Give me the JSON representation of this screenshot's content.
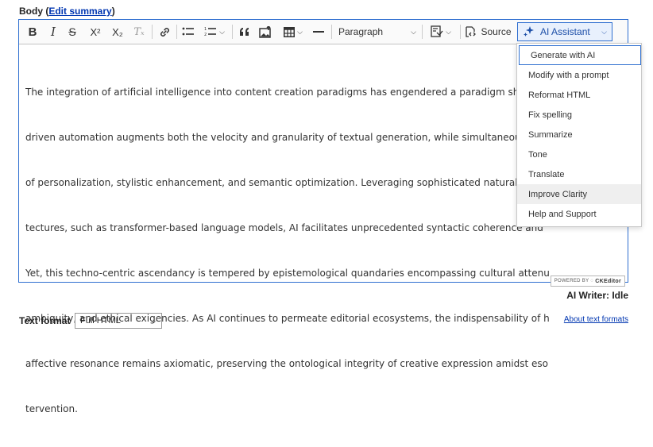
{
  "field": {
    "label": "Body",
    "edit_link_open": "(",
    "edit_link": "Edit summary",
    "edit_link_close": ")"
  },
  "toolbar": {
    "bold_icon": "B",
    "italic_icon": "I",
    "strike_icon": "S",
    "superscript_icon": "X²",
    "subscript_icon": "X₂",
    "remove_format_icon": "Tₓ",
    "paragraph_label": "Paragraph",
    "source_label": "Source",
    "ai_assistant_label": "AI Assistant"
  },
  "content_lines": [
    "The integration of artificial intelligence into content creation paradigms has engendered a paradigm shift, w",
    "driven automation augments both the velocity and granularity of textual generation, while simultaneously re",
    "of personalization, stylistic enhancement, and semantic optimization. Leveraging sophisticated natural langu",
    "tectures, such as transformer-based language models, AI facilitates unprecedented syntactic coherence and ",
    "Yet, this techno-centric ascendancy is tempered by epistemological quandaries encompassing cultural attenu",
    "ambiguity, and ethical exigencies. As AI continues to permeate editorial ecosystems, the indispensability of h",
    "affective resonance remains axiomatic, preserving the ontological integrity of creative expression amidst eso",
    "tervention."
  ],
  "powered_by": {
    "prefix": "POWERED BY",
    "brand": "CKEditor"
  },
  "ai_menu": {
    "items": [
      "Generate with AI",
      "Modify with a prompt",
      "Reformat HTML",
      "Fix spelling",
      "Summarize",
      "Tone",
      "Translate",
      "Improve Clarity",
      "Help and Support"
    ]
  },
  "ai_status": "AI Writer: Idle",
  "text_format": {
    "label": "Text format",
    "value": "Full HTML",
    "about_link": "About text formats"
  }
}
